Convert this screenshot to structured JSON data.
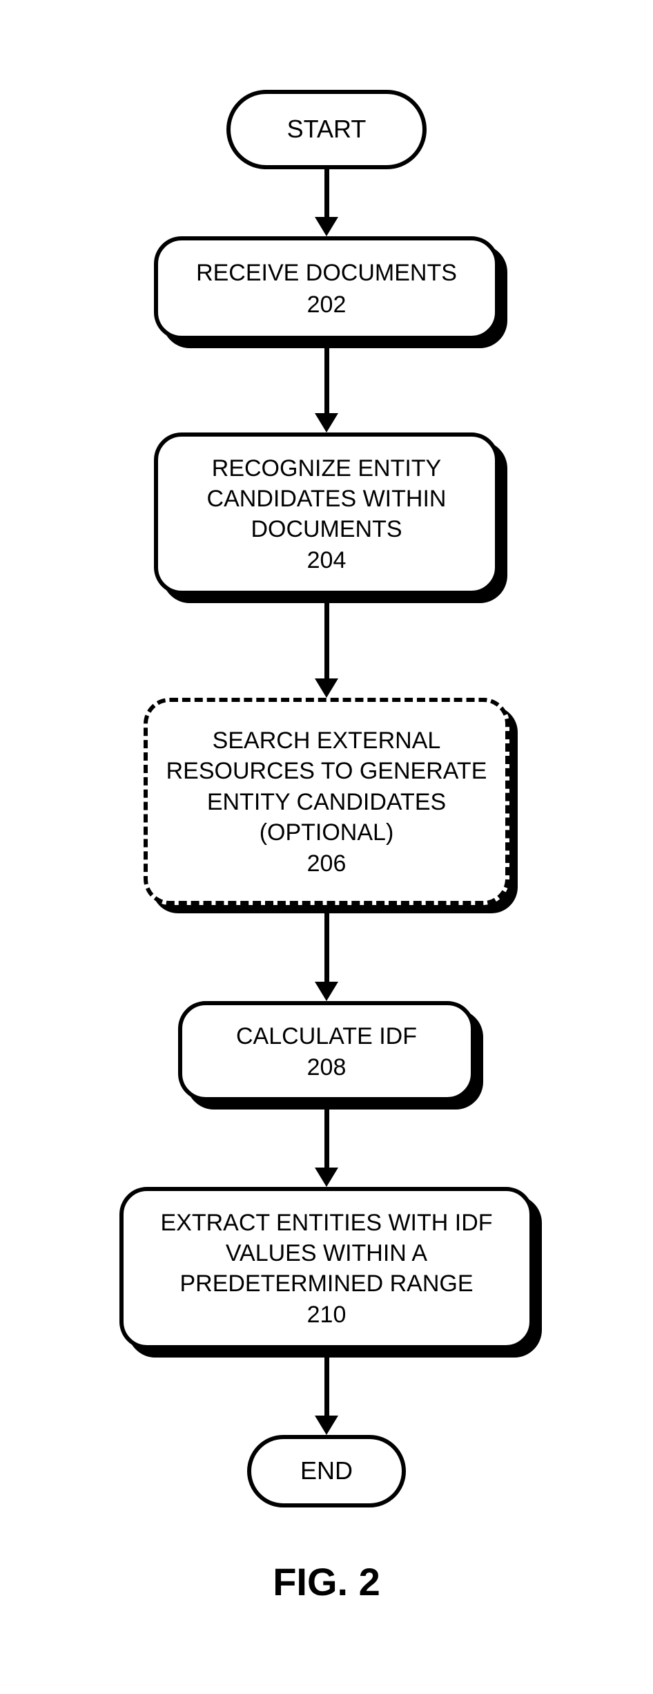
{
  "flowchart": {
    "start": "START",
    "end": "END",
    "steps": [
      {
        "text": "RECEIVE DOCUMENTS",
        "ref": "202"
      },
      {
        "text_line1": "RECOGNIZE ENTITY",
        "text_line2": "CANDIDATES WITHIN",
        "text_line3": "DOCUMENTS",
        "ref": "204"
      },
      {
        "text_line1": "SEARCH EXTERNAL",
        "text_line2": "RESOURCES TO GENERATE",
        "text_line3": "ENTITY CANDIDATES",
        "text_line4": "(OPTIONAL)",
        "ref": "206"
      },
      {
        "text": "CALCULATE IDF",
        "ref": "208"
      },
      {
        "text_line1": "EXTRACT ENTITIES WITH IDF",
        "text_line2": "VALUES WITHIN A",
        "text_line3": "PREDETERMINED RANGE",
        "ref": "210"
      }
    ],
    "figure_label": "FIG. 2"
  }
}
